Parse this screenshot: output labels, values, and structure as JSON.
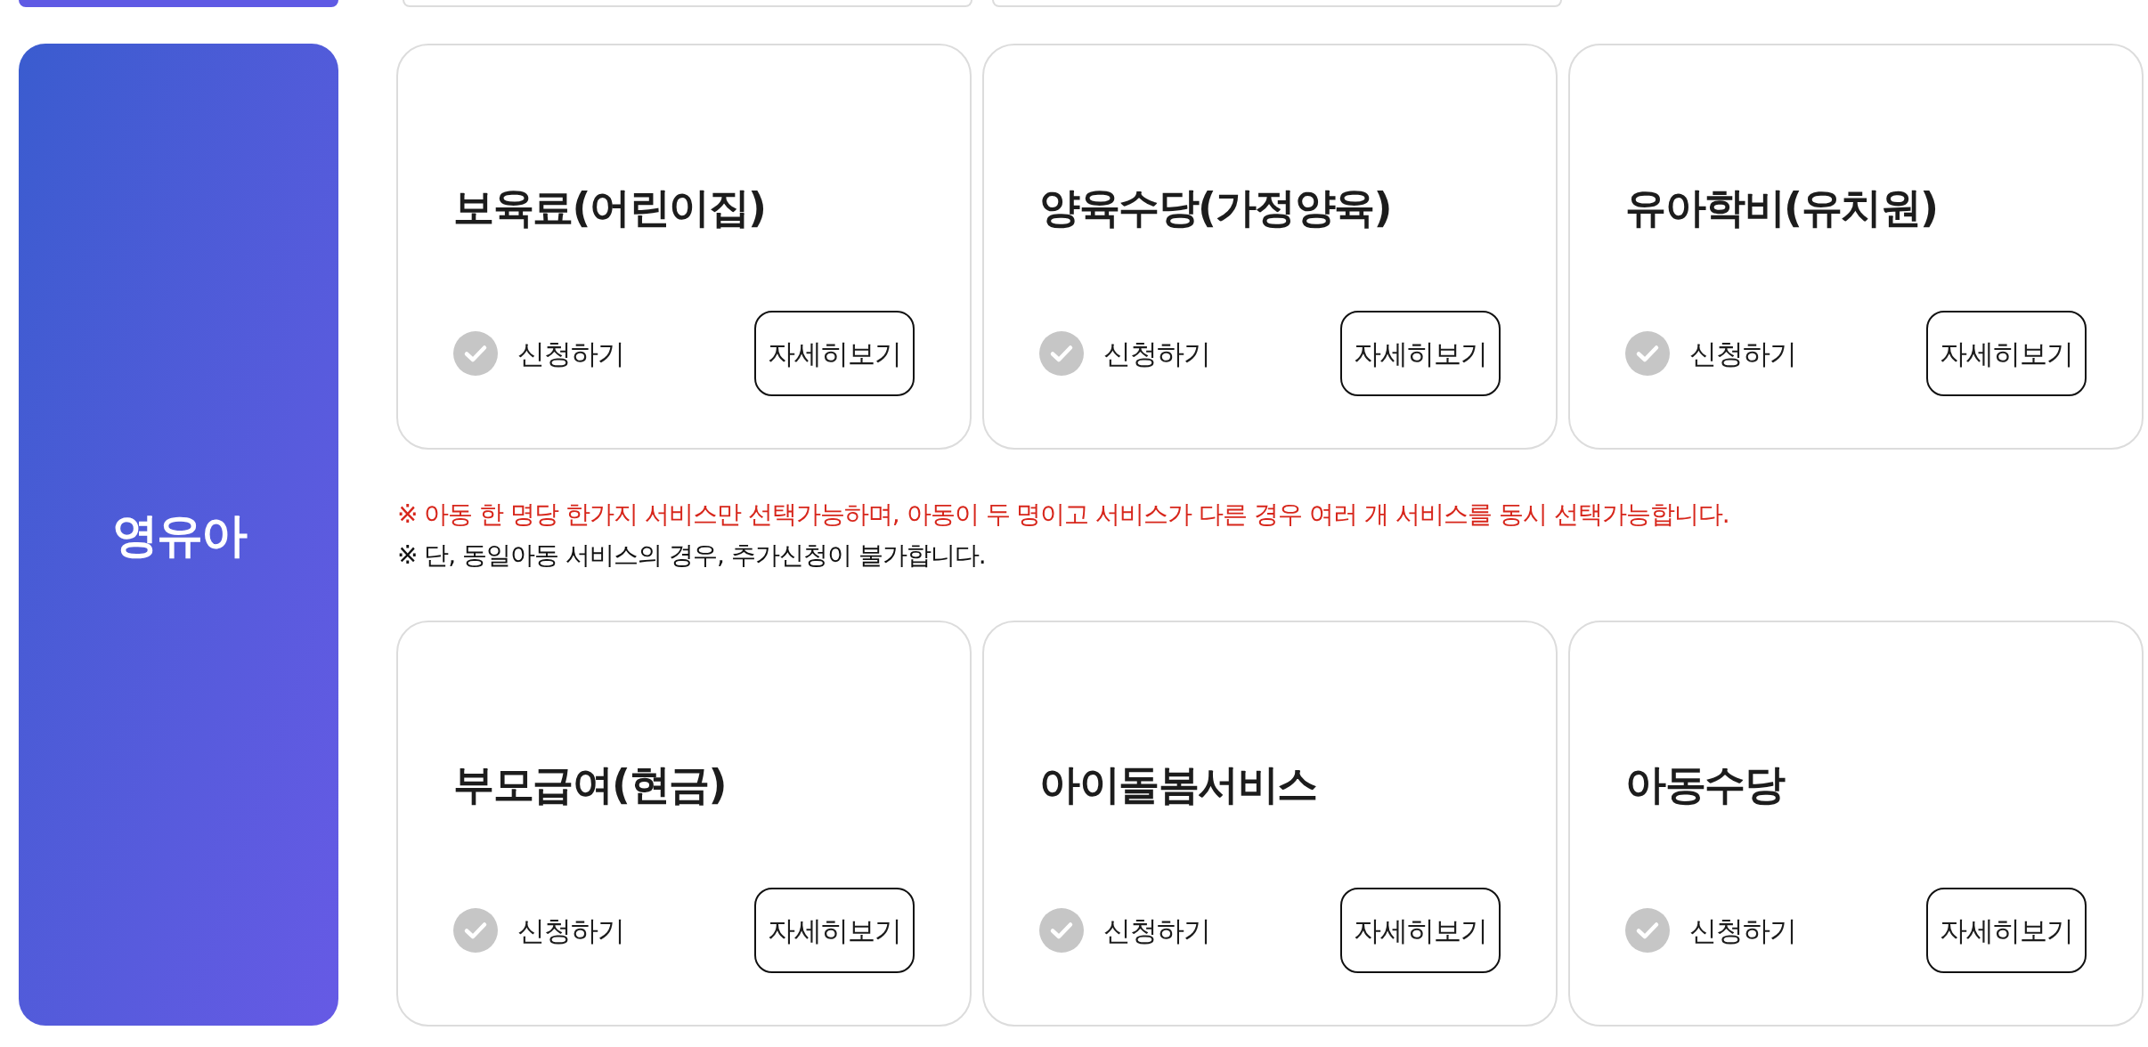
{
  "section": {
    "label": "영유아"
  },
  "cards_top": [
    {
      "title": "보육료(어린이집)",
      "apply_label": "신청하기",
      "checked": false,
      "details_label": "자세히보기"
    },
    {
      "title": "양육수당(가정양육)",
      "apply_label": "신청하기",
      "checked": false,
      "details_label": "자세히보기"
    },
    {
      "title": "유아학비(유치원)",
      "apply_label": "신청하기",
      "checked": false,
      "details_label": "자세히보기"
    }
  ],
  "notes": [
    {
      "kind": "warning",
      "text": "※ 아동 한 명당 한가지 서비스만 선택가능하며, 아동이 두 명이고 서비스가 다른 경우 여러 개 서비스를 동시 선택가능합니다."
    },
    {
      "kind": "plain",
      "text": "※ 단, 동일아동 서비스의 경우, 추가신청이 불가합니다."
    }
  ],
  "cards_bottom": [
    {
      "title": "부모급여(현금)",
      "apply_label": "신청하기",
      "checked": false,
      "details_label": "자세히보기"
    },
    {
      "title": "아이돌봄서비스",
      "apply_label": "신청하기",
      "checked": false,
      "details_label": "자세히보기"
    },
    {
      "title": "아동수당",
      "apply_label": "신청하기",
      "checked": false,
      "details_label": "자세히보기"
    }
  ]
}
